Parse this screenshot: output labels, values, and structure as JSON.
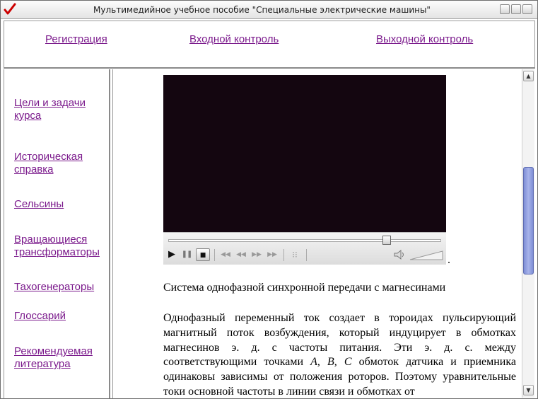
{
  "window": {
    "title": "Мультимедийное учебное пособие \"Специальные электрические машины\""
  },
  "top_nav": {
    "links": [
      "Регистрация",
      "Входной контроль",
      "Выходной контроль"
    ]
  },
  "side_nav": {
    "items": [
      "Цели и задачи курса",
      "Историческая справка",
      "Сельсины",
      "Вращающиеся трансформаторы",
      "Тахогенераторы",
      "Глоссарий",
      "Рекомендуемая литература"
    ]
  },
  "player": {
    "seek_position": 0.8,
    "colors": {
      "screen": "#140610",
      "controls": "#e6e6e6"
    }
  },
  "content": {
    "caption": "Система однофазной синхронной передачи с магнесинами",
    "paragraph_part1": "Однофазный переменный ток создает в тороидах пульсирующий магнитный поток возбуждения, который индуцирует в обмотках магнесинов э. д. с частоты питания. Эти э. д. с. между соответствующими точками ",
    "paragraph_italic": "A, B, C",
    "paragraph_part2": " обмоток датчика и приемника одинаковы зависимы от положения роторов. Поэтому уравнительные токи основной частоты в линии связи и обмотках от"
  },
  "colors": {
    "link": "#7b1a8c",
    "scroll_thumb": "#8f9ddc",
    "title_icon": "#cc0000"
  }
}
